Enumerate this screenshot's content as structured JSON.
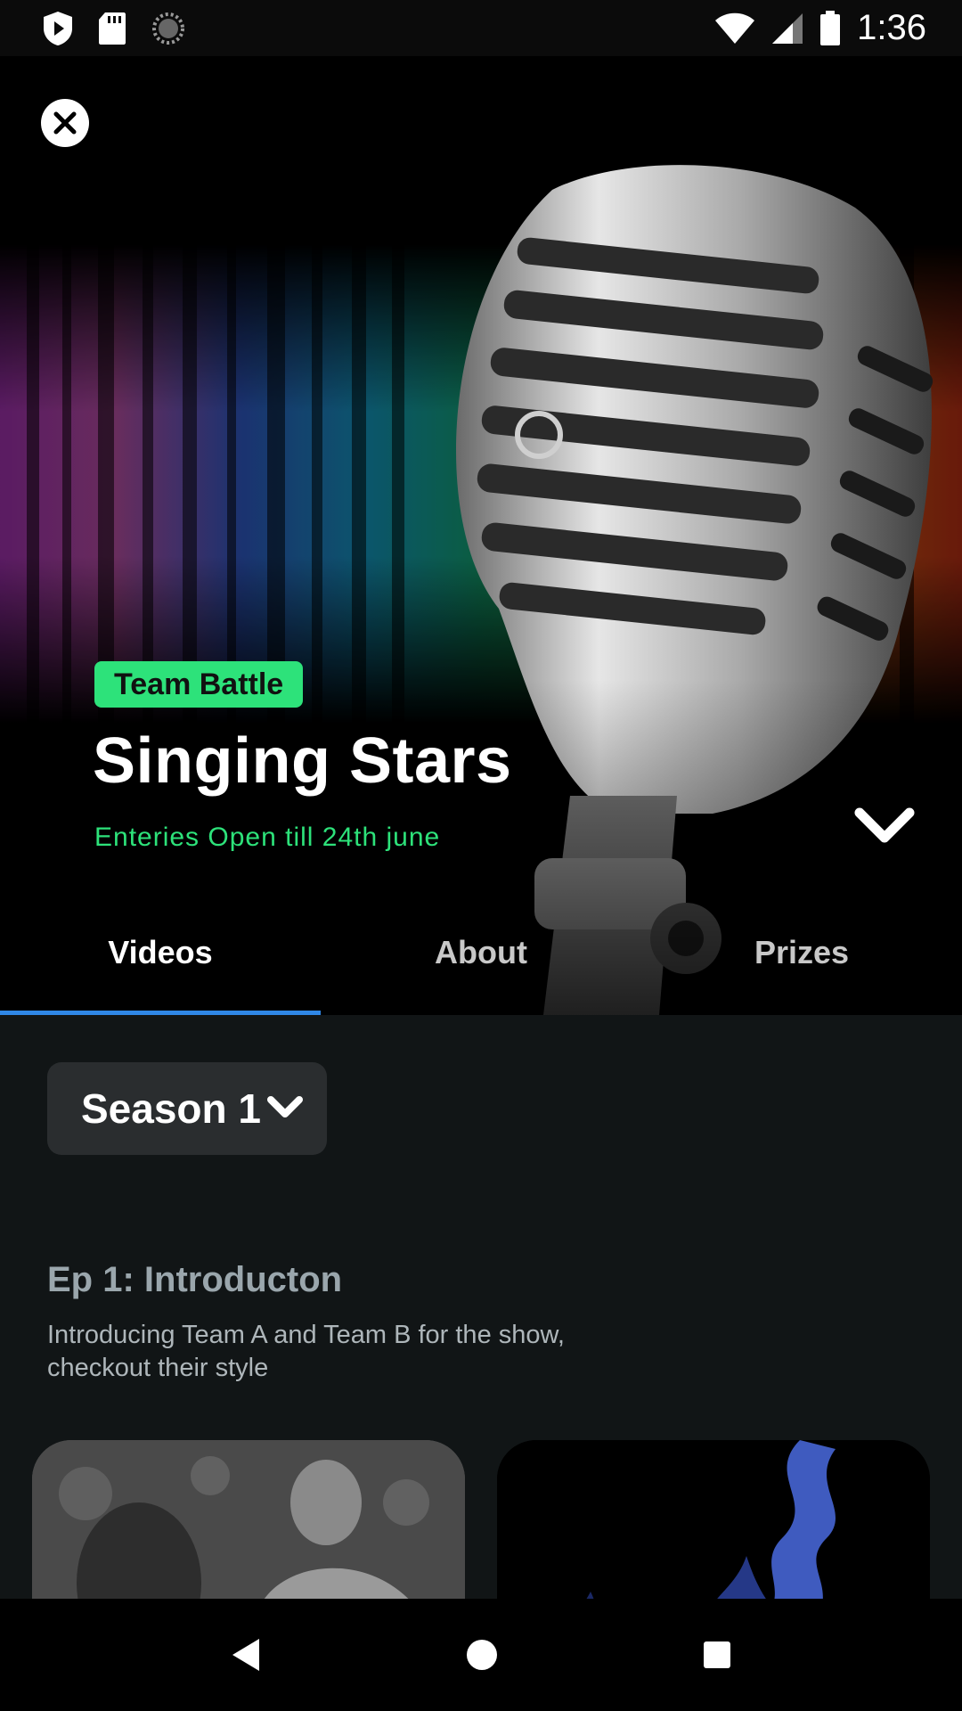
{
  "status_bar": {
    "time": "1:36",
    "icons": [
      "play-protect-icon",
      "sd-card-icon",
      "loading-icon",
      "wifi-icon",
      "signal-icon",
      "battery-icon"
    ]
  },
  "hero": {
    "badge": "Team Battle",
    "title": "Singing Stars",
    "subtitle": "Enteries Open till 24th june",
    "icons": [
      "close-icon",
      "chevron-down-icon"
    ]
  },
  "tabs": [
    {
      "label": "Videos",
      "active": true
    },
    {
      "label": "About",
      "active": false
    },
    {
      "label": "Prizes",
      "active": false
    }
  ],
  "season_selector": {
    "value": "Season 1"
  },
  "episode": {
    "title": "Ep 1: Introducton",
    "description": "Introducing Team A and Team B for the show, checkout their style"
  },
  "nav_bar": {
    "icons": [
      "back-icon",
      "home-icon",
      "recents-icon"
    ]
  },
  "colors": {
    "accent_green": "#2de27a",
    "tab_indicator": "#2f87e6",
    "background": "#111516"
  }
}
